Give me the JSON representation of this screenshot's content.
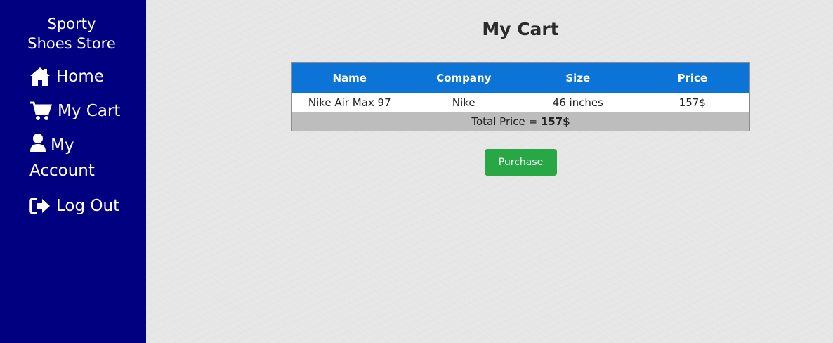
{
  "sidebar": {
    "brand_line1": "Sporty",
    "brand_line2": "Shoes Store",
    "items": [
      {
        "label": "Home",
        "icon": "home-icon"
      },
      {
        "label": "My Cart",
        "icon": "cart-icon"
      },
      {
        "label": "My Account",
        "icon": "user-icon",
        "label_line1": "My",
        "label_line2": "Account"
      },
      {
        "label": "Log Out",
        "icon": "logout-icon"
      }
    ]
  },
  "main": {
    "title": "My Cart",
    "table": {
      "headers": [
        "Name",
        "Company",
        "Size",
        "Price"
      ],
      "rows": [
        [
          "Nike Air Max 97",
          "Nike",
          "46 inches",
          "157$"
        ]
      ],
      "total_prefix": "Total Price = ",
      "total_value": "157$"
    },
    "purchase_label": "Purchase"
  },
  "colors": {
    "sidebar_bg": "#000080",
    "table_header_bg": "#0b74d6",
    "total_row_bg": "#bdbdbd",
    "purchase_button": "#28a745"
  }
}
